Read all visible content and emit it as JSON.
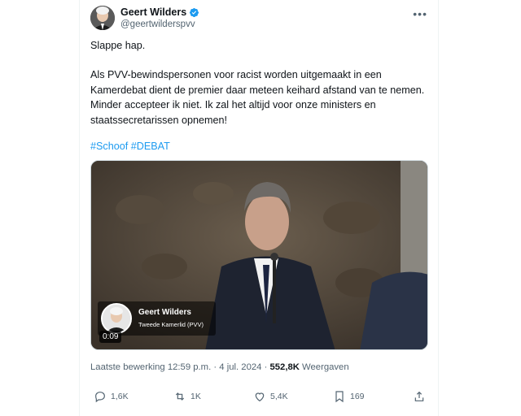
{
  "author": {
    "display_name": "Geert Wilders",
    "handle": "@geertwilderspvv",
    "verified": true
  },
  "menu_icon": "more-horizontal-icon",
  "tweet": {
    "line1": "Slappe hap.",
    "paragraph2": "Als PVV-bewindspersonen voor racist worden uitgemaakt in een Kamerdebat dient de premier daar meteen keihard afstand van te nemen. Minder accepteer ik niet. Ik zal het altijd voor onze ministers en staatssecretarissen opnemen!",
    "hashtag1": "#Schoof",
    "hashtag2": "#DEBAT"
  },
  "video": {
    "overlay_name": "Geert Wilders",
    "overlay_subtitle": "Tweede Kamerlid (PVV)",
    "duration": "0:09"
  },
  "meta": {
    "edited_label": "Laatste bewerking",
    "time": "12:59 p.m.",
    "separator": "·",
    "date": "4 jul. 2024",
    "views_count": "552,8K",
    "views_label": "Weergaven"
  },
  "actions": {
    "replies": "1,6K",
    "reposts": "1K",
    "likes": "5,4K",
    "bookmarks": "169"
  },
  "colors": {
    "accent": "#1d9bf0",
    "text": "#0f1419",
    "secondary": "#536471"
  }
}
